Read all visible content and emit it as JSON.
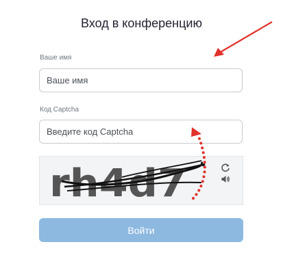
{
  "title": "Вход в конференцию",
  "name_field": {
    "label": "Ваше имя",
    "placeholder": "Ваше имя"
  },
  "captcha_field": {
    "label": "Код Captcha",
    "placeholder": "Введите код Captcha"
  },
  "captcha": {
    "text": "rh4d7",
    "refresh_icon": "refresh-icon",
    "audio_icon": "speaker-icon"
  },
  "submit_label": "Войти",
  "colors": {
    "accent": "#8db9e0",
    "annotation": "#e0322b",
    "text": "#232333"
  }
}
